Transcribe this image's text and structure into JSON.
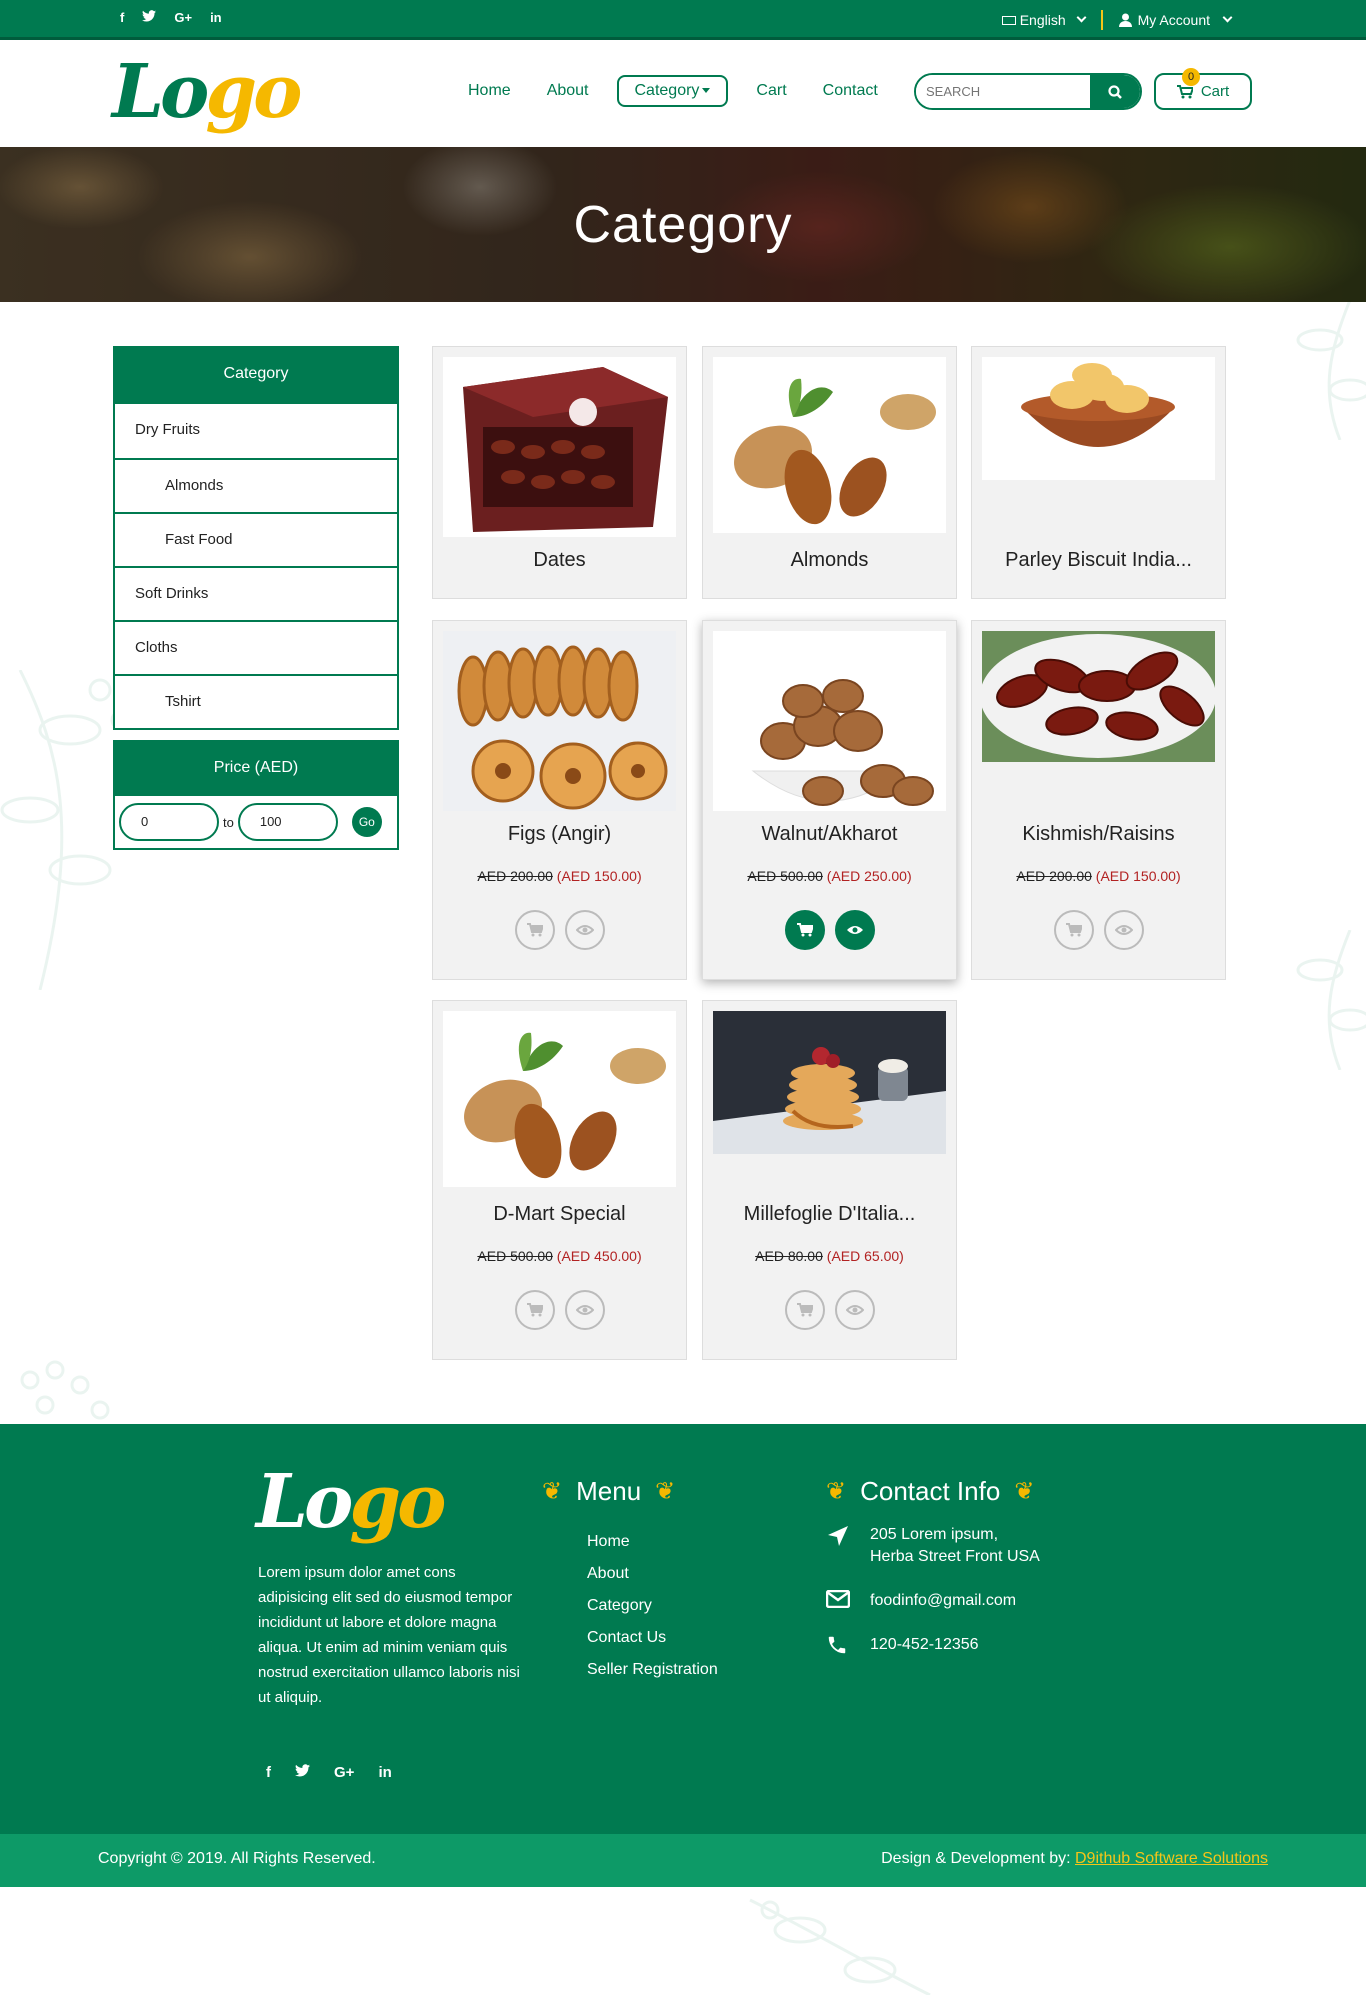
{
  "topbar": {
    "social": [
      "f",
      "t",
      "G+",
      "in"
    ],
    "language": "English",
    "account": "My Account"
  },
  "header": {
    "logo_a": "Lo",
    "logo_b": "go",
    "nav": [
      "Home",
      "About",
      "Category",
      "Cart",
      "Contact"
    ],
    "search_placeholder": "SEARCH",
    "cart_label": "Cart",
    "cart_count": "0"
  },
  "banner": {
    "title": "Category"
  },
  "sidebar": {
    "title": "Category",
    "items": [
      {
        "label": "Dry Fruits",
        "sub": false
      },
      {
        "label": "Almonds",
        "sub": true
      },
      {
        "label": "Fast Food",
        "sub": true
      },
      {
        "label": "Soft Drinks",
        "sub": false
      },
      {
        "label": "Cloths",
        "sub": false
      },
      {
        "label": "Tshirt",
        "sub": true
      }
    ],
    "price_title": "Price (AED)",
    "price_from": "0",
    "price_to_label": "to",
    "price_to": "100",
    "go": "Go"
  },
  "products": [
    {
      "name": "Dates",
      "old": "",
      "new": ""
    },
    {
      "name": "Almonds",
      "old": "",
      "new": ""
    },
    {
      "name": "Parley Biscuit India...",
      "old": "",
      "new": ""
    },
    {
      "name": "Figs (Angir)",
      "old": "AED 200.00",
      "new": "(AED 150.00)"
    },
    {
      "name": "Walnut/Akharot",
      "old": "AED 500.00",
      "new": "(AED 250.00)"
    },
    {
      "name": "Kishmish/Raisins",
      "old": "AED 200.00",
      "new": "(AED 150.00)"
    },
    {
      "name": "D-Mart Special",
      "old": "AED 500.00",
      "new": "(AED 450.00)"
    },
    {
      "name": "Millefoglie D'Italia...",
      "old": "AED 80.00",
      "new": "(AED 65.00)"
    }
  ],
  "footer": {
    "logo_a": "Lo",
    "logo_b": "go",
    "about": "Lorem ipsum dolor amet cons adipisicing elit sed do eiusmod tempor incididunt ut labore et dolore magna aliqua. Ut enim ad minim veniam quis nostrud exercitation ullamco laboris nisi ut aliquip.",
    "social": [
      "f",
      "t",
      "G+",
      "in"
    ],
    "menu_title": "Menu",
    "menu": [
      "Home",
      "About",
      "Category",
      "Contact Us",
      "Seller Registration"
    ],
    "contact_title": "Contact Info",
    "address_1": "205 Lorem ipsum,",
    "address_2": "Herba Street Front USA",
    "email": "foodinfo@gmail.com",
    "phone": "120-452-12356",
    "copyright": "Copyright © 2019. All Rights Reserved.",
    "credit_prefix": "Design & Development by: ",
    "credit_link": "D9ithub Software Solutions"
  },
  "colors": {
    "primary": "#007a50",
    "accent": "#f5b800",
    "sale": "#b22222"
  }
}
